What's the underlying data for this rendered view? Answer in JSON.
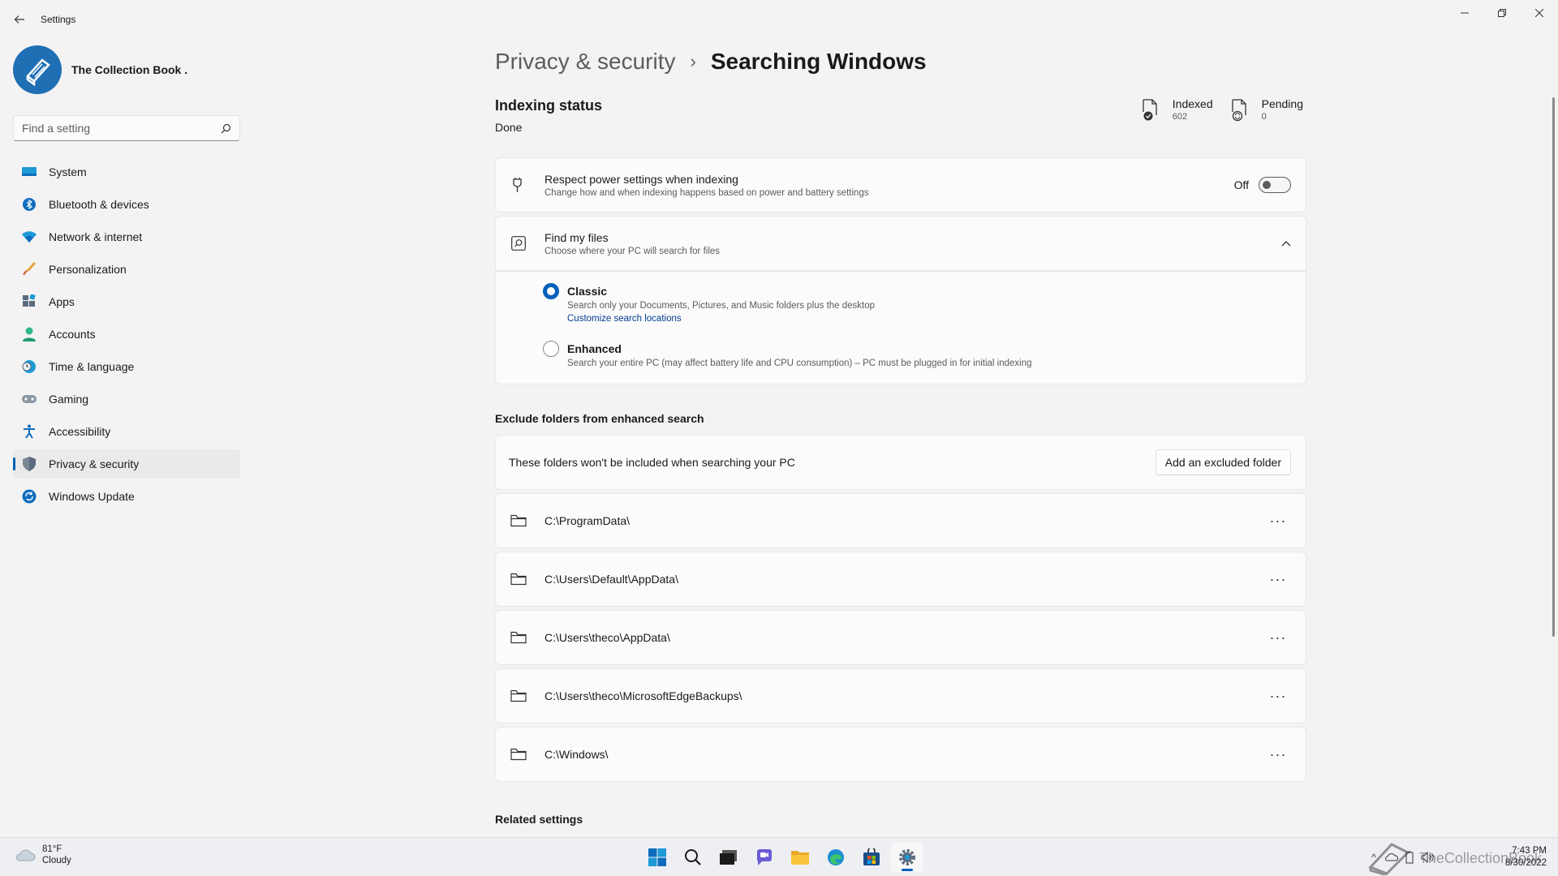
{
  "window": {
    "app_title": "Settings"
  },
  "profile": {
    "name": "The Collection Book ."
  },
  "search": {
    "placeholder": "Find a setting"
  },
  "sidebar": {
    "items": [
      {
        "label": "System",
        "icon": "system-icon"
      },
      {
        "label": "Bluetooth & devices",
        "icon": "bluetooth-icon"
      },
      {
        "label": "Network & internet",
        "icon": "wifi-icon"
      },
      {
        "label": "Personalization",
        "icon": "brush-icon"
      },
      {
        "label": "Apps",
        "icon": "apps-icon"
      },
      {
        "label": "Accounts",
        "icon": "account-icon"
      },
      {
        "label": "Time & language",
        "icon": "clock-globe-icon"
      },
      {
        "label": "Gaming",
        "icon": "gamepad-icon"
      },
      {
        "label": "Accessibility",
        "icon": "accessibility-icon"
      },
      {
        "label": "Privacy & security",
        "icon": "shield-icon",
        "active": true
      },
      {
        "label": "Windows Update",
        "icon": "update-icon"
      }
    ]
  },
  "breadcrumb": {
    "parent": "Privacy & security",
    "separator": "›",
    "current": "Searching Windows"
  },
  "indexing": {
    "title": "Indexing status",
    "status": "Done",
    "indexed_label": "Indexed",
    "indexed_value": "602",
    "pending_label": "Pending",
    "pending_value": "0"
  },
  "power_setting": {
    "title": "Respect power settings when indexing",
    "subtitle": "Change how and when indexing happens based on power and battery settings",
    "toggle_state_label": "Off",
    "toggle_on": false
  },
  "find_files": {
    "title": "Find my files",
    "subtitle": "Choose where your PC will search for files",
    "expanded": true,
    "options": [
      {
        "label": "Classic",
        "description": "Search only your Documents, Pictures, and Music folders plus the desktop",
        "link": "Customize search locations",
        "selected": true
      },
      {
        "label": "Enhanced",
        "description": "Search your entire PC (may affect battery life and CPU consumption) – PC must be plugged in for initial indexing",
        "selected": false
      }
    ]
  },
  "exclude": {
    "heading": "Exclude folders from enhanced search",
    "info": "These folders won't be included when searching your PC",
    "add_button": "Add an excluded folder",
    "folders": [
      "C:\\ProgramData\\",
      "C:\\Users\\Default\\AppData\\",
      "C:\\Users\\theco\\AppData\\",
      "C:\\Users\\theco\\MicrosoftEdgeBackups\\",
      "C:\\Windows\\"
    ],
    "more_label": "···"
  },
  "related": {
    "heading": "Related settings"
  },
  "taskbar": {
    "weather_temp": "81°F",
    "weather_condition": "Cloudy",
    "time": "7:43 PM",
    "date": "8/30/2022",
    "watermark": "TheCollectionBook",
    "apps": [
      "start-icon",
      "search-icon",
      "task-view-icon",
      "chat-icon",
      "file-explorer-icon",
      "edge-icon",
      "store-icon",
      "settings-icon"
    ]
  },
  "colors": {
    "accent": "#005fb8",
    "background": "#f3f3f3",
    "card": "#fbfbfb"
  }
}
